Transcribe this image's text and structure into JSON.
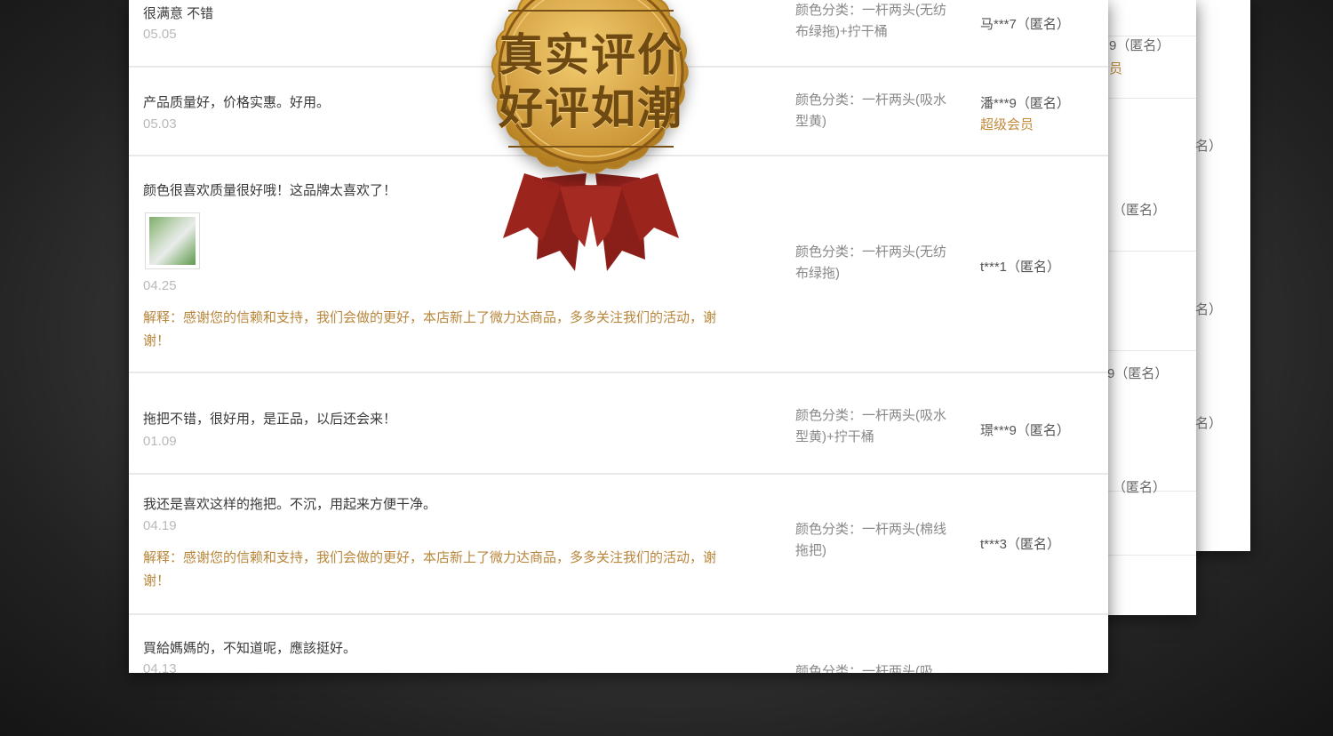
{
  "medal": {
    "line1": "真实评价",
    "line2": "好评如潮"
  },
  "reviews": [
    {
      "comment": "很满意 不错",
      "date": "05.05",
      "spec": "颜色分类：一杆两头(无纺布绿拖)+拧干桶",
      "user": "马***7（匿名）",
      "badge": "",
      "reply": ""
    },
    {
      "comment": "产品质量好，价格实惠。好用。",
      "date": "05.03",
      "spec": "颜色分类：一杆两头(吸水型黄)",
      "user": "潘***9（匿名）",
      "badge": "超级会员",
      "reply": ""
    },
    {
      "comment": "颜色很喜欢质量很好哦！这品牌太喜欢了！",
      "date": "04.25",
      "spec": "颜色分类：一杆两头(无纺布绿拖)",
      "user": "t***1（匿名）",
      "badge": "",
      "reply": "解释：感谢您的信赖和支持，我们会做的更好，本店新上了微力达商品，多多关注我们的活动，谢谢！"
    },
    {
      "comment": "拖把不错，很好用，是正品，以后还会来！",
      "date": "01.09",
      "spec": "颜色分类：一杆两头(吸水型黄)+拧干桶",
      "user": "璟***9（匿名）",
      "badge": "",
      "reply": ""
    },
    {
      "comment": "我还是喜欢这样的拖把。不沉，用起来方便干净。",
      "date": "04.19",
      "spec": "颜色分类：一杆两头(棉线拖把)",
      "user": "t***3（匿名）",
      "badge": "",
      "reply": "解释：感谢您的信赖和支持，我们会做的更好，本店新上了微力达商品，多多关注我们的活动，谢谢！"
    },
    {
      "comment": "買給媽媽的，不知道呢，應該挺好。",
      "date": "04.13",
      "spec": "颜色分类：一杆两头(吸",
      "user": "",
      "badge": "",
      "reply": ""
    }
  ],
  "back_sheet_1": [
    "9（匿名）",
    "员",
    "名）",
    "（匿名）",
    "名）",
    "9（匿名）",
    "名）",
    "（匿名）"
  ]
}
